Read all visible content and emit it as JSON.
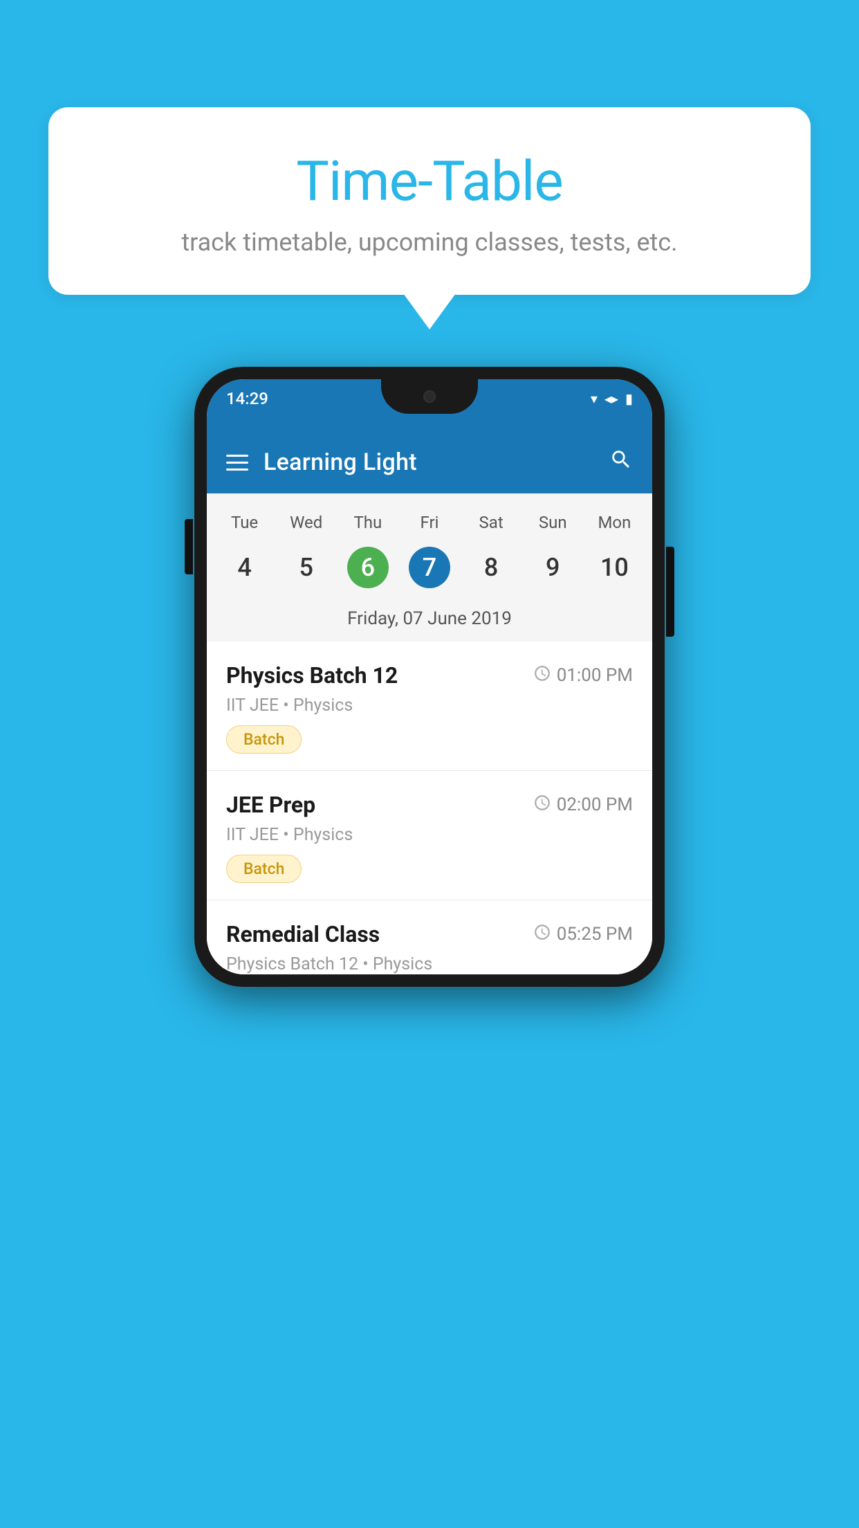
{
  "background_color": "#29b6e8",
  "speech_bubble": {
    "title": "Time-Table",
    "subtitle": "track timetable, upcoming classes, tests, etc."
  },
  "phone": {
    "status_bar": {
      "time": "14:29"
    },
    "app_bar": {
      "title": "Learning Light"
    },
    "calendar": {
      "day_labels": [
        "Tue",
        "Wed",
        "Thu",
        "Fri",
        "Sat",
        "Sun",
        "Mon"
      ],
      "dates": [
        {
          "num": "4",
          "state": "normal"
        },
        {
          "num": "5",
          "state": "normal"
        },
        {
          "num": "6",
          "state": "today"
        },
        {
          "num": "7",
          "state": "selected"
        },
        {
          "num": "8",
          "state": "normal"
        },
        {
          "num": "9",
          "state": "normal"
        },
        {
          "num": "10",
          "state": "normal"
        }
      ],
      "selected_date_label": "Friday, 07 June 2019"
    },
    "schedule": [
      {
        "title": "Physics Batch 12",
        "time": "01:00 PM",
        "subtitle": "IIT JEE • Physics",
        "badge": "Batch"
      },
      {
        "title": "JEE Prep",
        "time": "02:00 PM",
        "subtitle": "IIT JEE • Physics",
        "badge": "Batch"
      },
      {
        "title": "Remedial Class",
        "time": "05:25 PM",
        "subtitle": "Physics Batch 12 • Physics",
        "badge": null
      }
    ]
  }
}
